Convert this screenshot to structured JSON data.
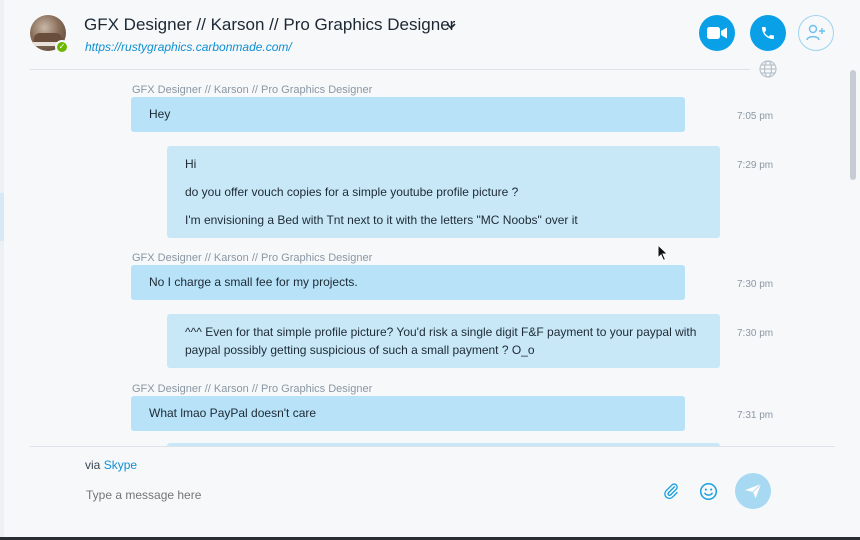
{
  "header": {
    "title": "GFX Designer // Karson // Pro Graphics Designer",
    "link": "https://rustygraphics.carbonmade.com/",
    "presence": "✓"
  },
  "messages": [
    {
      "sender": "GFX Designer // Karson // Pro Graphics Designer",
      "direction": "in",
      "lines": [
        "Hey"
      ],
      "time": "7:05 pm"
    },
    {
      "sender": "",
      "direction": "out",
      "lines": [
        "Hi",
        "do you offer vouch copies for a simple youtube profile picture ?",
        "I'm envisioning a Bed with Tnt next to it with the letters \"MC Noobs\" over it"
      ],
      "time": "7:29 pm"
    },
    {
      "sender": "GFX Designer // Karson // Pro Graphics Designer",
      "direction": "in",
      "lines": [
        "No I charge a small fee for my projects."
      ],
      "time": "7:30 pm"
    },
    {
      "sender": "",
      "direction": "out",
      "lines": [
        "^^^ Even for that simple profile picture? You'd risk a single digit F&F payment to your paypal with",
        "paypal possibly getting suspicious of such a small payment ? O_o"
      ],
      "time": "7:30 pm"
    },
    {
      "sender": "GFX Designer // Karson // Pro Graphics Designer",
      "direction": "in",
      "lines": [
        "What lmao PayPal doesn't care"
      ],
      "time": "7:31 pm"
    }
  ],
  "composer": {
    "via_prefix": "via",
    "via_service": "Skype",
    "placeholder": "Type a message here"
  },
  "colors": {
    "accent": "#0aa0e8",
    "incoming_bubble": "#b7e2f8",
    "outgoing_bubble": "#c8e8f8",
    "presence_online": "#6bb700"
  },
  "icons": {
    "video_call": "video-camera-icon",
    "audio_call": "phone-icon",
    "add_people": "add-person-icon",
    "globe": "globe-icon",
    "attach": "paperclip-icon",
    "emoji": "smiley-icon",
    "send": "send-icon"
  }
}
